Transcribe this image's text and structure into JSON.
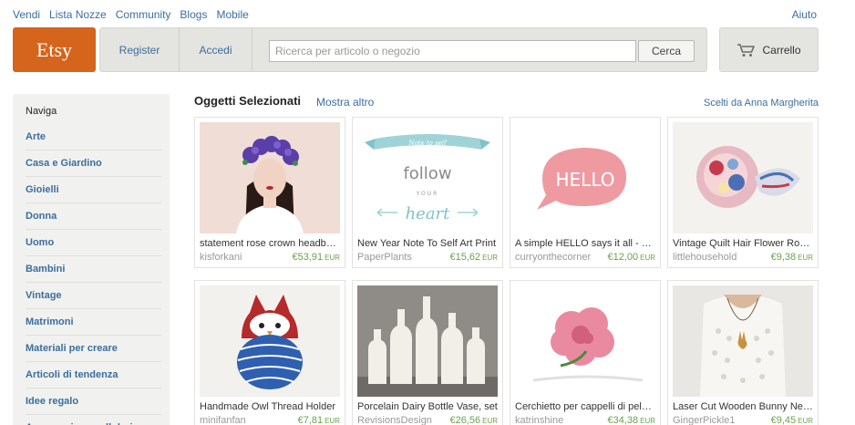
{
  "top_links": [
    "Vendi",
    "Lista Nozze",
    "Community",
    "Blogs",
    "Mobile"
  ],
  "help_link": "Aiuto",
  "logo": "Etsy",
  "nav": {
    "register": "Register",
    "login": "Accedi"
  },
  "search": {
    "placeholder": "Ricerca per articolo o negozio",
    "value": "",
    "button": "Cerca"
  },
  "cart_label": "Carrello",
  "sidebar": {
    "heading": "Naviga",
    "items": [
      "Arte",
      "Casa e Giardino",
      "Gioielli",
      "Donna",
      "Uomo",
      "Bambini",
      "Vintage",
      "Matrimoni",
      "Materiali per creare",
      "Articoli di tendenza",
      "Idee regalo",
      "Accessori per cellulari e"
    ]
  },
  "featured": {
    "title": "Oggetti Selezionati",
    "more": "Mostra altro",
    "curator": "Scelti da Anna Margherita",
    "items": [
      {
        "title": "statement rose crown headband",
        "shop": "kisforkani",
        "price": "€53,91",
        "currency": "EUR",
        "image": "flower-crown-woman"
      },
      {
        "title": "New Year Note To Self Art Print",
        "shop": "PaperPlants",
        "price": "€15,62",
        "currency": "EUR",
        "image": "follow-your-heart-print"
      },
      {
        "title": "A simple HELLO says it all - print",
        "shop": "curryonthecorner",
        "price": "€12,00",
        "currency": "EUR",
        "image": "hello-speech-bubble"
      },
      {
        "title": "Vintage Quilt Hair Flower Rosette",
        "shop": "littlehousehold",
        "price": "€9,38",
        "currency": "EUR",
        "image": "quilt-hair-flower"
      },
      {
        "title": "Handmade Owl Thread Holder",
        "shop": "minifanfan",
        "price": "€7,81",
        "currency": "EUR",
        "image": "owl-thread-holder"
      },
      {
        "title": "Porcelain Dairy Bottle Vase, set",
        "shop": "RevisionsDesign",
        "price": "€26,56",
        "currency": "EUR",
        "image": "porcelain-bottles"
      },
      {
        "title": "Cerchietto per cappelli di peluche",
        "shop": "katrinshine",
        "price": "€34,38",
        "currency": "EUR",
        "image": "pink-flower"
      },
      {
        "title": "Laser Cut Wooden Bunny Necklace",
        "shop": "GingerPickle1",
        "price": "€9,45",
        "currency": "EUR",
        "image": "lace-dress-necklace"
      }
    ]
  },
  "hello_text": "HELLO",
  "print_text": {
    "top": "Note to self",
    "line1": "follow",
    "line2": "YOUR",
    "line3": "heart"
  },
  "colors": {
    "link": "#3b6e9e",
    "logo_bg": "#d5641c",
    "price": "#6aa24c",
    "sidebar_bg": "#f1f1ef"
  }
}
